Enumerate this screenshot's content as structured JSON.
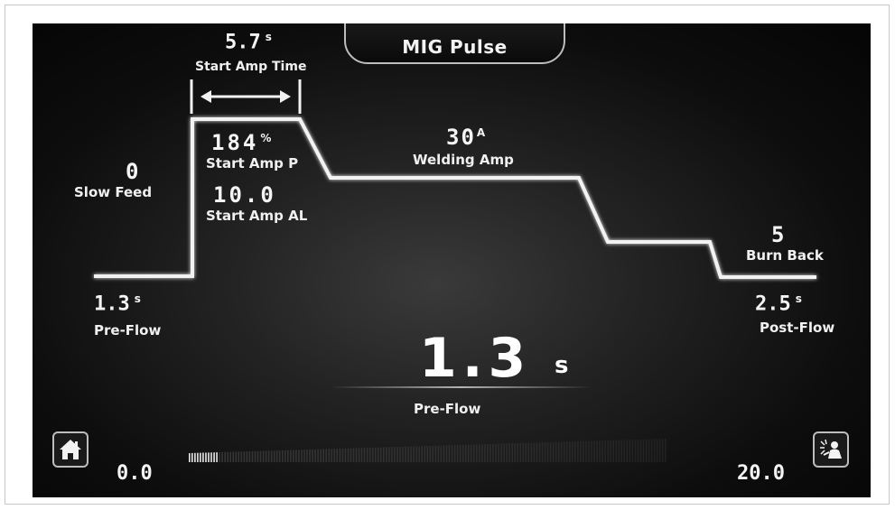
{
  "mode": {
    "label": "MIG Pulse"
  },
  "start_amp_time": {
    "value": "5.7",
    "unit": "s",
    "label": "Start Amp Time"
  },
  "start_amp_p": {
    "value": "184",
    "unit": "%",
    "label": "Start Amp P"
  },
  "start_amp_al": {
    "value": "10.0",
    "label": "Start Amp AL"
  },
  "slow_feed": {
    "value": "0",
    "label": "Slow Feed"
  },
  "welding_amp": {
    "value": "30",
    "unit": "A",
    "label": "Welding Amp"
  },
  "burn_back": {
    "value": "5",
    "label": "Burn Back"
  },
  "pre_flow": {
    "value": "1.3",
    "unit": "s",
    "label": "Pre-Flow"
  },
  "post_flow": {
    "value": "2.5",
    "unit": "s",
    "label": "Post-Flow"
  },
  "selected": {
    "value": "1.3",
    "unit": "s",
    "label": "Pre-Flow"
  },
  "slider": {
    "min_label": "0.0",
    "max_label": "20.0",
    "level_fraction": 0.065
  },
  "icons": {
    "home": "home-icon",
    "welder": "welder-icon"
  },
  "colors": {
    "line": "#f2f2f2",
    "screen_bg": "#111111"
  }
}
